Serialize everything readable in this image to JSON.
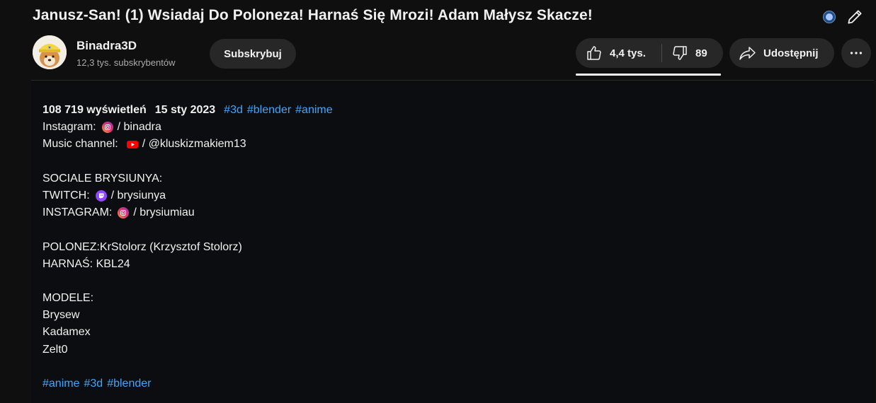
{
  "video": {
    "title": "Janusz-San! (1) Wsiadaj Do Poloneza! Harnaś Się Mrozi! Adam Małysz Skacze!"
  },
  "channel": {
    "name": "Binadra3D",
    "subscribers": "12,3 tys. subskrybentów",
    "subscribe_label": "Subskrybuj"
  },
  "actions": {
    "likes": "4,4 tys.",
    "dislikes": "89",
    "share_label": "Udostępnij"
  },
  "description": {
    "views": "108 719 wyświetleń",
    "date": "15 sty 2023",
    "tags_top": [
      "#3d",
      "#blender",
      "#anime"
    ],
    "instagram_label": "Instagram:",
    "instagram_link": "/ binadra",
    "music_label": "Music channel:",
    "music_link": "/ @kluskizmakiem13",
    "sociale_heading": "SOCIALE BRYSIUNYA:",
    "twitch_label": "TWITCH:",
    "twitch_link": "/ brysiunya",
    "instagram2_label": "INSTAGRAM:",
    "instagram2_link": "/ brysiumiau",
    "polonez": "POLONEZ:KrStolorz (Krzysztof Stolorz)",
    "harnas": "HARNAŚ: KBL24",
    "modele_heading": "MODELE:",
    "models": [
      "Brysew",
      "Kadamex",
      "Zelt0"
    ],
    "tags_bottom": [
      "#anime",
      "#3d",
      "#blender"
    ]
  },
  "colors": {
    "background": "#0f0f0f",
    "button_bg": "#272727",
    "hashtag": "#3ea6ff",
    "secondary_text": "#aaaaaa"
  },
  "icons": [
    "record-dot-icon",
    "pencil-icon",
    "thumbs-up-icon",
    "thumbs-down-icon",
    "share-arrow-icon",
    "more-horizontal-icon",
    "instagram-icon",
    "youtube-icon",
    "twitch-icon"
  ]
}
